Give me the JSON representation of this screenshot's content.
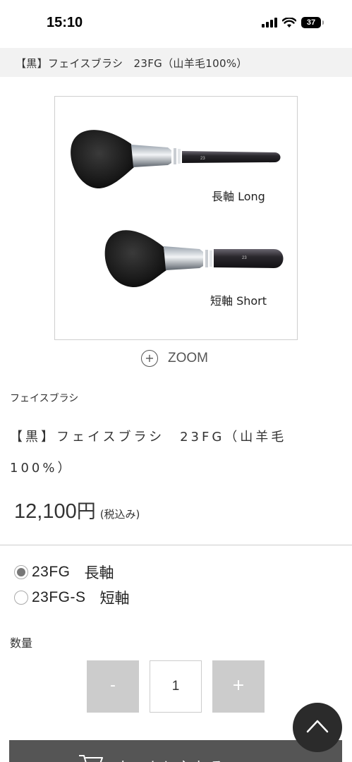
{
  "status_bar": {
    "time": "15:10",
    "battery": "37",
    "icons": [
      "signal-icon",
      "wifi-icon",
      "battery-icon"
    ]
  },
  "breadcrumb": {
    "text": "【黒】フェイスブラシ　23FG（山羊毛100%）"
  },
  "product_image": {
    "caption_long": "長軸 Long",
    "caption_short": "短軸 Short",
    "handle_print_long": "23",
    "handle_print_short": "23"
  },
  "zoom": {
    "label": "ZOOM",
    "icon": "plus-circle-icon"
  },
  "product": {
    "category": "フェイスブラシ",
    "name": "【黒】フェイスブラシ　23FG（山羊毛100%）",
    "price": "12,100",
    "currency": "円",
    "tax_note": "(税込み)"
  },
  "variants": [
    {
      "code": "23FG",
      "label": "長軸",
      "selected": true
    },
    {
      "code": "23FG-S",
      "label": "短軸",
      "selected": false
    }
  ],
  "quantity": {
    "label": "数量",
    "value": "1",
    "minus": "-",
    "plus": "+"
  },
  "cart": {
    "label": "カートに入れる",
    "icon": "cart-icon"
  },
  "scroll_top": {
    "icon": "chevron-up-icon"
  },
  "colors": {
    "breadcrumb_bg": "#f2f2f2",
    "qty_button_bg": "#cccccc",
    "cart_button_bg": "#555555",
    "scroll_top_bg": "#2b2b2b"
  }
}
